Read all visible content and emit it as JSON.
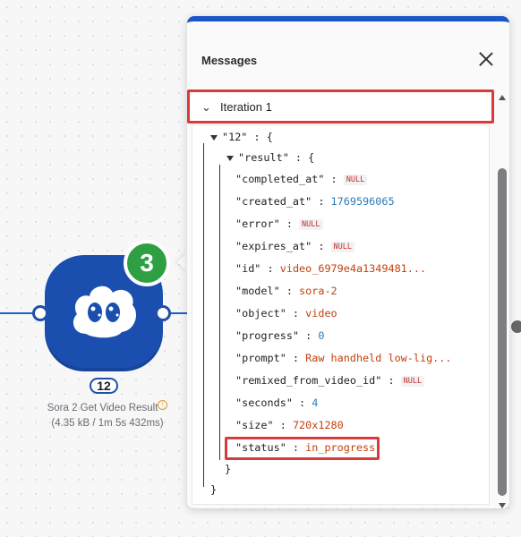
{
  "canvas": {
    "node": {
      "badge_count": "3",
      "operations_count": "12",
      "title": "Sora 2 Get Video Result",
      "subtitle": "(4.35 kB / 1m 5s 432ms)"
    }
  },
  "panel": {
    "title": "Messages",
    "iteration_label": "Iteration 1",
    "tree": {
      "root_key": "\"12\"",
      "result_key": "\"result\"",
      "fields": [
        {
          "key": "\"completed_at\"",
          "type": "null",
          "value": "NULL"
        },
        {
          "key": "\"created_at\"",
          "type": "num",
          "value": "1769596065"
        },
        {
          "key": "\"error\"",
          "type": "null",
          "value": "NULL"
        },
        {
          "key": "\"expires_at\"",
          "type": "null",
          "value": "NULL"
        },
        {
          "key": "\"id\"",
          "type": "str",
          "value": "video_6979e4a1349481..."
        },
        {
          "key": "\"model\"",
          "type": "str",
          "value": "sora-2"
        },
        {
          "key": "\"object\"",
          "type": "str",
          "value": "video"
        },
        {
          "key": "\"progress\"",
          "type": "num",
          "value": "0"
        },
        {
          "key": "\"prompt\"",
          "type": "str",
          "value": "Raw handheld low-lig..."
        },
        {
          "key": "\"remixed_from_video_id\"",
          "type": "null",
          "value": "NULL"
        },
        {
          "key": "\"seconds\"",
          "type": "num",
          "value": "4"
        },
        {
          "key": "\"size\"",
          "type": "str",
          "value": "720x1280"
        },
        {
          "key": "\"status\"",
          "type": "str",
          "value": "in_progress"
        }
      ]
    }
  },
  "colors": {
    "node_blue": "#1a4fb0",
    "badge_green": "#2ea043",
    "highlight_red": "#d93b3b"
  }
}
